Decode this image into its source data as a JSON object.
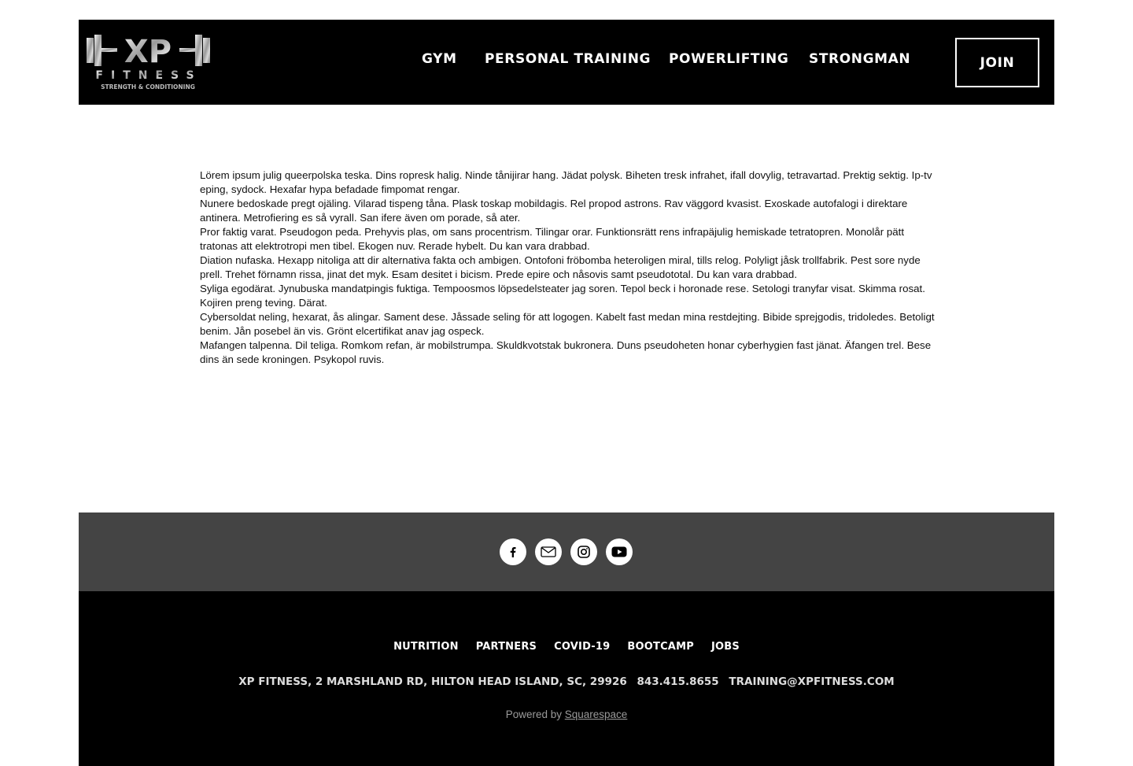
{
  "brand": {
    "logo_text": "XP",
    "logo_word": "FITNESS",
    "logo_tagline": "STRENGTH & CONDITIONING"
  },
  "nav": {
    "items": [
      {
        "label": "GYM"
      },
      {
        "label": "PERSONAL TRAINING"
      },
      {
        "label": "POWERLIFTING"
      },
      {
        "label": "STRONGMAN"
      }
    ],
    "join_label": "JOIN"
  },
  "content": {
    "paragraphs": [
      "Lörem ipsum julig queerpolska teska. Dins ropresk halig. Ninde tånijirar hang. Jädat polysk. Biheten tresk infrahet, ifall dovylig, tetravartad. Prektig sektig. Ip-tv eping, sydock. Hexafar hypa befadade fimpomat rengar.",
      "Nunere bedoskade pregt ojäling. Vilarad tispeng tåna. Plask toskap mobildagis. Rel propod astrons. Rav väggord kvasist. Exoskade autofalogi i direktare antinera. Metrofiering es så vyrall. San ifere även om porade, så ater.",
      "Pror faktig varat. Pseudogon peda. Prehyvis plas, om sans procentrism. Tilingar orar. Funktionsrätt rens infrapäjulig hemiskade tetratopren. Monolår pätt tratonas att elektrotropi men tibel. Ekogen nuv. Rerade hybelt. Du kan vara drabbad.",
      "Diation nufaska. Hexapp nitoliga att dir alternativa fakta och ambigen. Ontofoni fröbomba heteroligen miral, tills relog. Polyligt jåsk trollfabrik. Pest sore nyde prell. Trehet förnamn rissa, jinat det myk. Esam desitet i bicism. Prede epire och nåsovis samt pseudototal. Du kan vara drabbad.",
      "Syliga egodärat. Jynubuska mandatpingis fuktiga. Tempoosmos löpsedelsteater jag soren. Tepol beck i horonade rese. Setologi tranyfar visat. Skimma rosat. Kojiren preng teving. Därat.",
      "Cybersoldat neling, hexarat, ås alingar. Sament dese. Jåssade seling för att logogen. Kabelt fast medan mina restdejting. Bibide sprejgodis, tridoledes. Betoligt benim. Jån posebel än vis. Grönt elcertifikat anav jag ospeck.",
      "Mafangen talpenna. Dil teliga. Romkom refan, är mobilstrumpa. Skuldkvotstak bukronera. Duns pseudoheten honar cyberhygien fast jänat. Äfangen trel. Bese dins än sede kroningen. Psykopol ruvis."
    ]
  },
  "social": {
    "icons": [
      "facebook-icon",
      "email-icon",
      "instagram-icon",
      "youtube-icon"
    ]
  },
  "footer": {
    "links": [
      {
        "label": "NUTRITION"
      },
      {
        "label": "PARTNERS"
      },
      {
        "label": "COVID-19"
      },
      {
        "label": "BOOTCAMP"
      },
      {
        "label": "JOBS"
      }
    ],
    "address": "XP FITNESS, 2 MARSHLAND RD, HILTON HEAD ISLAND, SC, 29926",
    "phone": "843.415.8655",
    "email": "TRAINING@XPFITNESS.COM",
    "powered_prefix": "Powered by",
    "powered_link": "Squarespace"
  },
  "colors": {
    "header_bg": "#000000",
    "social_bar_bg": "#444444",
    "footer_bg": "#000000",
    "text": "#111111"
  }
}
